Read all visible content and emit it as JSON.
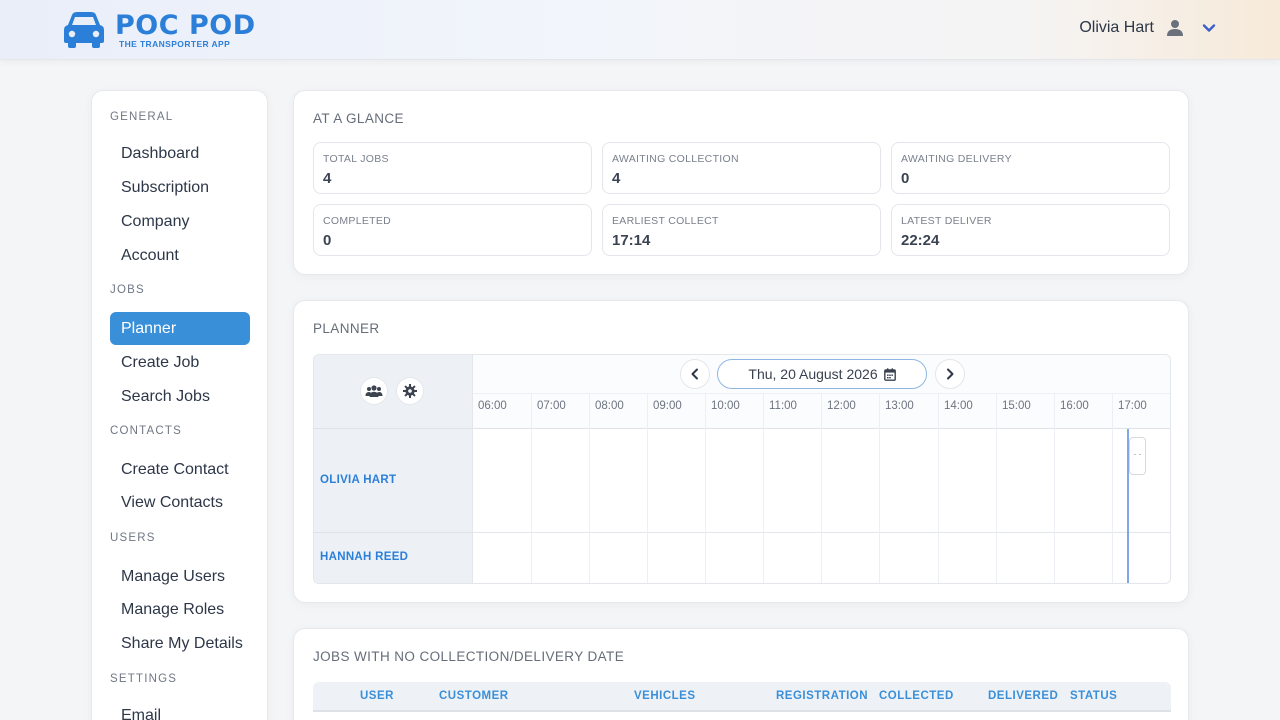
{
  "header": {
    "brand_title": "POC POD",
    "brand_subtitle": "THE TRANSPORTER APP",
    "user_name": "Olivia Hart"
  },
  "sidebar": {
    "sections": [
      {
        "title": "GENERAL",
        "items": [
          "Dashboard",
          "Subscription",
          "Company",
          "Account"
        ]
      },
      {
        "title": "JOBS",
        "items": [
          "Planner",
          "Create Job",
          "Search Jobs"
        ]
      },
      {
        "title": "CONTACTS",
        "items": [
          "Create Contact",
          "View Contacts"
        ]
      },
      {
        "title": "USERS",
        "items": [
          "Manage Users",
          "Manage Roles",
          "Share My Details"
        ]
      },
      {
        "title": "SETTINGS",
        "items": [
          "Email"
        ]
      }
    ],
    "active_item": "Planner"
  },
  "glance": {
    "title": "AT A GLANCE",
    "stats": [
      {
        "label": "TOTAL JOBS",
        "value": "4"
      },
      {
        "label": "AWAITING COLLECTION",
        "value": "4"
      },
      {
        "label": "AWAITING DELIVERY",
        "value": "0"
      },
      {
        "label": "COMPLETED",
        "value": "0"
      },
      {
        "label": "EARLIEST COLLECT",
        "value": "17:14"
      },
      {
        "label": "LATEST DELIVER",
        "value": "22:24"
      }
    ]
  },
  "planner": {
    "title": "PLANNER",
    "date_label": "Thu, 20 August 2026",
    "hours": [
      "06:00",
      "07:00",
      "08:00",
      "09:00",
      "10:00",
      "11:00",
      "12:00",
      "13:00",
      "14:00",
      "15:00",
      "16:00",
      "17:00"
    ],
    "resources": [
      "OLIVIA HART",
      "HANNAH REED"
    ],
    "event_chip_text": ". ."
  },
  "jobs_table": {
    "title": "JOBS WITH NO COLLECTION/DELIVERY DATE",
    "columns": [
      "USER",
      "CUSTOMER",
      "VEHICLES",
      "REGISTRATION",
      "COLLECTED",
      "DELIVERED",
      "STATUS"
    ]
  },
  "colors": {
    "accent": "#3a8fd9",
    "brand": "#2b7fd8",
    "now_line": "#7ea8e8"
  }
}
